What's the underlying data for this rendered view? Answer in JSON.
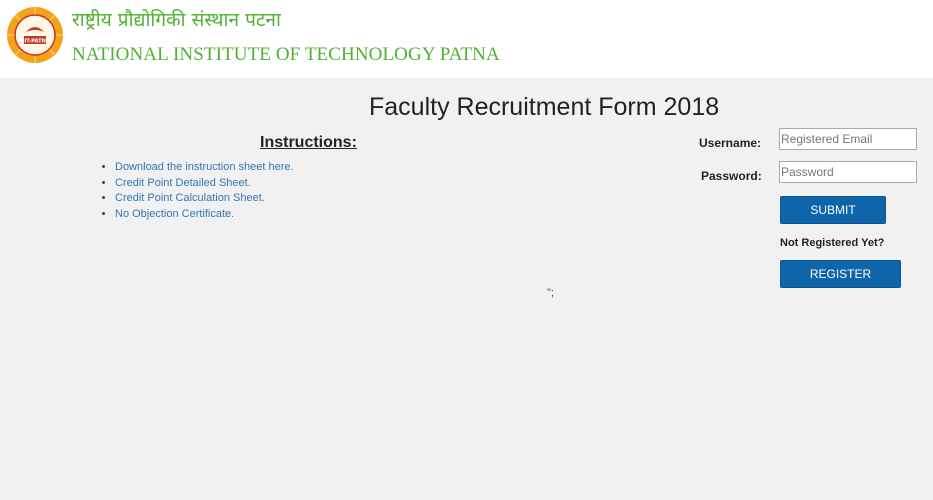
{
  "header": {
    "hindi_name": "राष्ट्रीय प्रौद्योगिकी संस्थान पटना",
    "english_name": "NATIONAL INSTITUTE OF TECHNOLOGY PATNA",
    "logo_text": "NIT-PATNA",
    "logo_icon": "nit-patna-emblem",
    "brand_color": "#4fb22f"
  },
  "main": {
    "title": "Faculty Recruitment Form 2018",
    "instructions_heading": "Instructions:",
    "instructions": [
      "Download the instruction sheet here.",
      "Credit Point Detailed Sheet.",
      "Credit Point Calculation Sheet.",
      "No Objection Certificate."
    ],
    "stray_text": "\";",
    "link_color": "#3276b8"
  },
  "login": {
    "username_label": "Username:",
    "username_placeholder": "Registered Email",
    "username_value": "",
    "password_label": "Password:",
    "password_placeholder": "Password",
    "password_value": "",
    "submit_label": "SUBMIT",
    "not_registered_text": "Not Registered Yet?",
    "register_label": "REGISTER",
    "button_color": "#0e65a9"
  }
}
